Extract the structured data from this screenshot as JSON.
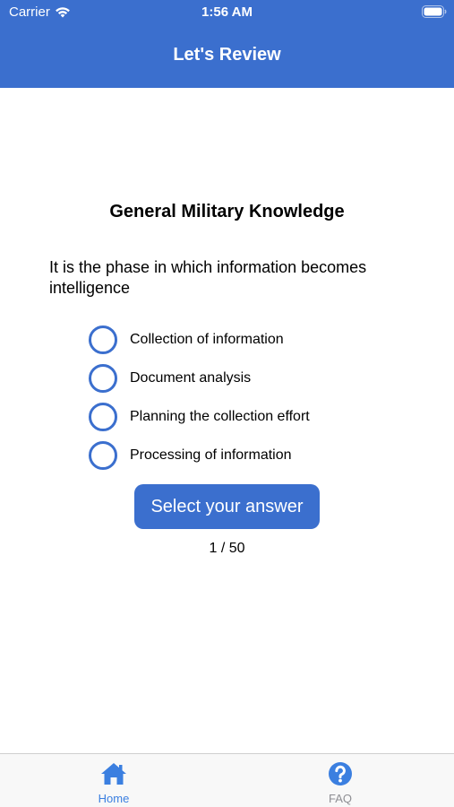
{
  "status_bar": {
    "carrier": "Carrier",
    "time": "1:56 AM",
    "wifi_icon": "wifi-icon",
    "battery_icon": "battery-icon"
  },
  "header": {
    "title": "Let's Review",
    "background_color": "#3b6fce"
  },
  "quiz": {
    "category": "General Military Knowledge",
    "question": "It is the phase in which information becomes intelligence",
    "options": [
      {
        "label": "Collection of information",
        "selected": false
      },
      {
        "label": "Document analysis",
        "selected": false
      },
      {
        "label": "Planning the collection effort",
        "selected": false
      },
      {
        "label": "Processing of information",
        "selected": false
      }
    ],
    "answer_button_label": "Select your answer",
    "progress": "1 / 50"
  },
  "tab_bar": {
    "tabs": [
      {
        "label": "Home",
        "icon": "home-icon",
        "active": true,
        "color": "#3b7fe0"
      },
      {
        "label": "FAQ",
        "icon": "question-circle-icon",
        "active": false,
        "color": "#8e8e93"
      }
    ]
  }
}
